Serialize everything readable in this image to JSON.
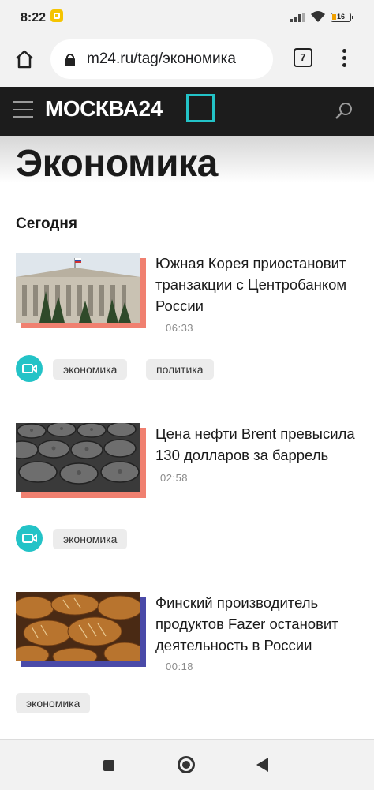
{
  "status_bar": {
    "time": "8:22",
    "battery": "16"
  },
  "browser": {
    "url": "m24.ru/tag/экономика",
    "tab_count": "7"
  },
  "site": {
    "logo": "МОСКВА24"
  },
  "page": {
    "title": "Экономика",
    "section": "Сегодня"
  },
  "articles": [
    {
      "headline": "Южная Корея приостановит транзакции с Центробанком России",
      "time": "06:33",
      "accent": "#f08070",
      "has_video": true,
      "tags": [
        "экономика",
        "политика"
      ]
    },
    {
      "headline": "Цена нефти Brent превысила 130 долларов за баррель",
      "time": "02:58",
      "accent": "#f08070",
      "has_video": true,
      "tags": [
        "экономика"
      ]
    },
    {
      "headline": "Финский производитель продуктов Fazer остановит деятельность в России",
      "time": "00:18",
      "accent": "#4a4aa8",
      "has_video": false,
      "tags": [
        "экономика"
      ]
    }
  ],
  "icons": [
    "home-icon",
    "lock-icon",
    "menu-icon",
    "search-icon",
    "video-icon",
    "back-icon"
  ]
}
